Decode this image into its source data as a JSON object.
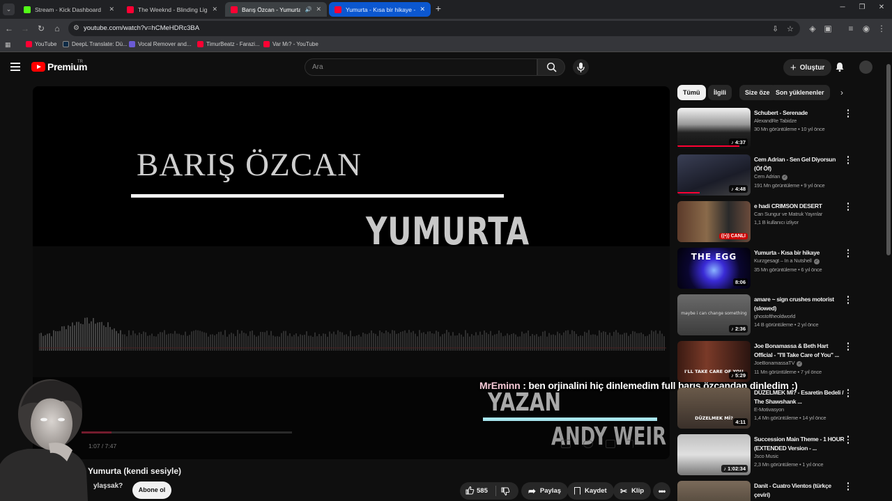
{
  "browser": {
    "tabs": [
      {
        "title": "Stream - Kick Dashboard",
        "favicon_color": "#53fc18"
      },
      {
        "title": "The Weeknd - Blinding Lights (",
        "favicon_color": "#ff0033"
      },
      {
        "title": "Barış Özcan - Yumurta (kend",
        "favicon_color": "#ff0033"
      },
      {
        "title": "Yumurta - Kısa bir hikaye - You",
        "favicon_color": "#ff0033"
      }
    ],
    "url": "youtube.com/watch?v=hCMeHDRc3BA",
    "bookmarks": [
      {
        "label": "YouTube",
        "favicon_color": "#ff0033"
      },
      {
        "label": "DeepL Translate: Dü...",
        "favicon_color": "#0f2b46"
      },
      {
        "label": "Vocal Remover and...",
        "favicon_color": "#6b5bd6"
      },
      {
        "label": "TimurBeatz - Farazi...",
        "favicon_color": "#ff0033"
      },
      {
        "label": "Var Mı? - YouTube",
        "favicon_color": "#ff0033"
      }
    ]
  },
  "header": {
    "logo_text": "Premium",
    "logo_badge": "TR",
    "search_placeholder": "Ara",
    "create_label": "Oluştur"
  },
  "player": {
    "artist": "BARIŞ ÖZCAN",
    "song": "YUMURTA",
    "writer_label": "YAZAN",
    "writer": "ANDY WEIR",
    "time": "1:07 / 7:47",
    "progress_fraction": 0.143
  },
  "chat": {
    "user": "MrEminn",
    "message": " : ben orjinalini hiç dinlemedim full barış özcandan dinledim :)"
  },
  "video": {
    "title": "Yumurta (kendi sesiyle)",
    "share_question": "ylaşsak?",
    "subscribe_label": "Abone ol",
    "likes": "585",
    "share_label": "Paylaş",
    "save_label": "Kaydet",
    "clip_label": "Klip"
  },
  "chips": [
    "Tümü",
    "İlgili",
    "Size özel",
    "Son yüklenenler"
  ],
  "recommendations": [
    {
      "title": "Schubert - Serenade",
      "channel": "AlexandRe Tabidze",
      "meta": "30 Mn görüntüleme • 10 yıl önce",
      "duration": "4:37",
      "music": true,
      "watched": 0.85
    },
    {
      "title": "Cem Adrian - Sen Gel Diyorsun (Öf Öf)",
      "channel": "Cem Adrian",
      "verified": true,
      "meta": "191 Mn görüntüleme • 9 yıl önce",
      "duration": "4:48",
      "music": true,
      "watched": 0.3
    },
    {
      "title": "e hadi CRIMSON DESERT",
      "channel": "Can Sungur ve Matruk Yayınlar",
      "meta": "1,1 B kullanıcı izliyor",
      "duration": "CANLI",
      "live": true
    },
    {
      "title": "Yumurta - Kısa bir hikaye",
      "channel": "Kurzgesagt – In a Nutshell",
      "verified": true,
      "meta": "35 Mn görüntüleme • 6 yıl önce",
      "duration": "8:06",
      "thumb_text": "THE EGG"
    },
    {
      "title": "amare ~ sign crushes motorist (slowed)",
      "channel": "ghostoftheoldworld",
      "meta": "14 B görüntüleme • 2 yıl önce",
      "duration": "2:36",
      "music": true,
      "thumb_text": "maybe i can change something"
    },
    {
      "title": "Joe Bonamassa & Beth Hart Official - \"I'll Take Care of You\" ...",
      "channel": "JoeBonamassaTV",
      "verified": true,
      "meta": "11 Mn görüntüleme • 7 yıl önce",
      "duration": "5:29",
      "music": true,
      "thumb_text": "I'LL TAKE CARE OF YOU"
    },
    {
      "title": "DÜZELMEK Mİ? - Esaretin Bedeli / The Shawshank ...",
      "channel": "E-Motivasyon",
      "meta": "1,4 Mn görüntüleme • 14 yıl önce",
      "duration": "4:11",
      "thumb_text": "DÜZELMEK Mİ?"
    },
    {
      "title": "Succession Main Theme - 1 HOUR (EXTENDED Version - ...",
      "channel": "Jsco Music",
      "meta": "2,3 Mn görüntüleme • 1 yıl önce",
      "duration": "1:02:34",
      "music": true
    },
    {
      "title": "Danit - Cuatro Vientos (türkçe çeviri)",
      "channel": "",
      "meta": "",
      "duration": ""
    }
  ]
}
